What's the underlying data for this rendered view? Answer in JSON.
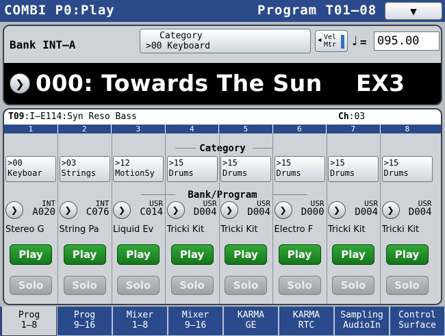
{
  "titlebar": {
    "mode": "COMBI P0:Play",
    "program_range": "Program T01–08",
    "menu_glyph": "⌵"
  },
  "header": {
    "bank": "Bank INT–A",
    "category_title": "Category",
    "category_value": ">00 Keyboard",
    "velmtr_line1": "Vel",
    "velmtr_line2": "Mtr",
    "tempo_label": "=",
    "tempo_value": "095.00",
    "combi_name": "000: Towards The Sun",
    "combi_suffix": "EX3"
  },
  "info": {
    "timbre": "T09",
    "program": ":I–E114:Syn Reso Bass",
    "ch_label": "Ch",
    "ch_value": ":03"
  },
  "sections": {
    "category": "Category",
    "bank_program": "Bank/Program"
  },
  "timbres": [
    {
      "num": "1",
      "cat1": ">00",
      "cat2": "Keyboar",
      "bank": "INT",
      "prog": "A020",
      "name": "Stereo G",
      "play": "Play",
      "solo": "Solo"
    },
    {
      "num": "2",
      "cat1": ">03",
      "cat2": "Strings",
      "bank": "INT",
      "prog": "C076",
      "name": "String Pa",
      "play": "Play",
      "solo": "Solo"
    },
    {
      "num": "3",
      "cat1": ">12",
      "cat2": "MotionSy",
      "bank": "USR",
      "prog": "C014",
      "name": "Liquid Ev",
      "play": "Play",
      "solo": "Solo"
    },
    {
      "num": "4",
      "cat1": ">15",
      "cat2": "Drums",
      "bank": "USR",
      "prog": "D004",
      "name": "Tricki Kit",
      "play": "Play",
      "solo": "Solo"
    },
    {
      "num": "5",
      "cat1": ">15",
      "cat2": "Drums",
      "bank": "USR",
      "prog": "D004",
      "name": "Tricki Kit",
      "play": "Play",
      "solo": "Solo"
    },
    {
      "num": "6",
      "cat1": ">15",
      "cat2": "Drums",
      "bank": "USR",
      "prog": "D000",
      "name": "Electro F",
      "play": "Play",
      "solo": "Solo"
    },
    {
      "num": "7",
      "cat1": ">15",
      "cat2": "Drums",
      "bank": "USR",
      "prog": "D004",
      "name": "Tricki Kit",
      "play": "Play",
      "solo": "Solo"
    },
    {
      "num": "8",
      "cat1": ">15",
      "cat2": "Drums",
      "bank": "USR",
      "prog": "D004",
      "name": "Tricki Kit",
      "play": "Play",
      "solo": "Solo"
    }
  ],
  "tabs": [
    {
      "l1": "Prog",
      "l2": "1–8"
    },
    {
      "l1": "Prog",
      "l2": "9–16"
    },
    {
      "l1": "Mixer",
      "l2": "1–8"
    },
    {
      "l1": "Mixer",
      "l2": "9–16"
    },
    {
      "l1": "KARMA",
      "l2": "GE"
    },
    {
      "l1": "KARMA",
      "l2": "RTC"
    },
    {
      "l1": "Sampling",
      "l2": "AudioIn"
    },
    {
      "l1": "Control",
      "l2": "Surface"
    }
  ],
  "active_tab": 0,
  "colors": {
    "titlebar": "#2a4a8c",
    "play_green": "#15761c",
    "panel": "#cfd3d7"
  }
}
